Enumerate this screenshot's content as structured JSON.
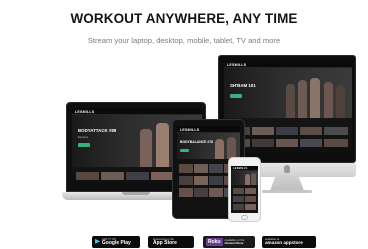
{
  "header": {
    "title": "WORKOUT ANYWHERE, ANY TIME",
    "subtitle": "Stream your laptop, desktop, mobile, tablet, TV and more"
  },
  "devices": {
    "desktop": {
      "logo": "LESMILLS",
      "hero_title": "SH'BAM 101"
    },
    "laptop": {
      "logo": "LESMILLS",
      "hero_title": "BODYATTACK #89",
      "hero_sub": "Express"
    },
    "tablet": {
      "logo": "LESMILLS",
      "hero_title": "BODYBALANCE #78"
    },
    "phone": {
      "logo": "LESMILLS"
    }
  },
  "badges": {
    "google_play": {
      "small": "GET IT ON",
      "big": "Google Play",
      "icon": "play-triangle-icon"
    },
    "app_store": {
      "small": "Download on the",
      "big": "App Store",
      "icon": "apple-icon"
    },
    "roku": {
      "logo": "Roku",
      "small": "Available on the",
      "big": "Channel Store"
    },
    "amazon": {
      "small": "available at",
      "big": "amazon appstore",
      "icon": "amazon-icon"
    }
  },
  "colors": {
    "accent_green": "#33b27a",
    "roku_purple": "#6c3c97",
    "title_text": "#151515",
    "subtitle_text": "#7d7d7d"
  }
}
